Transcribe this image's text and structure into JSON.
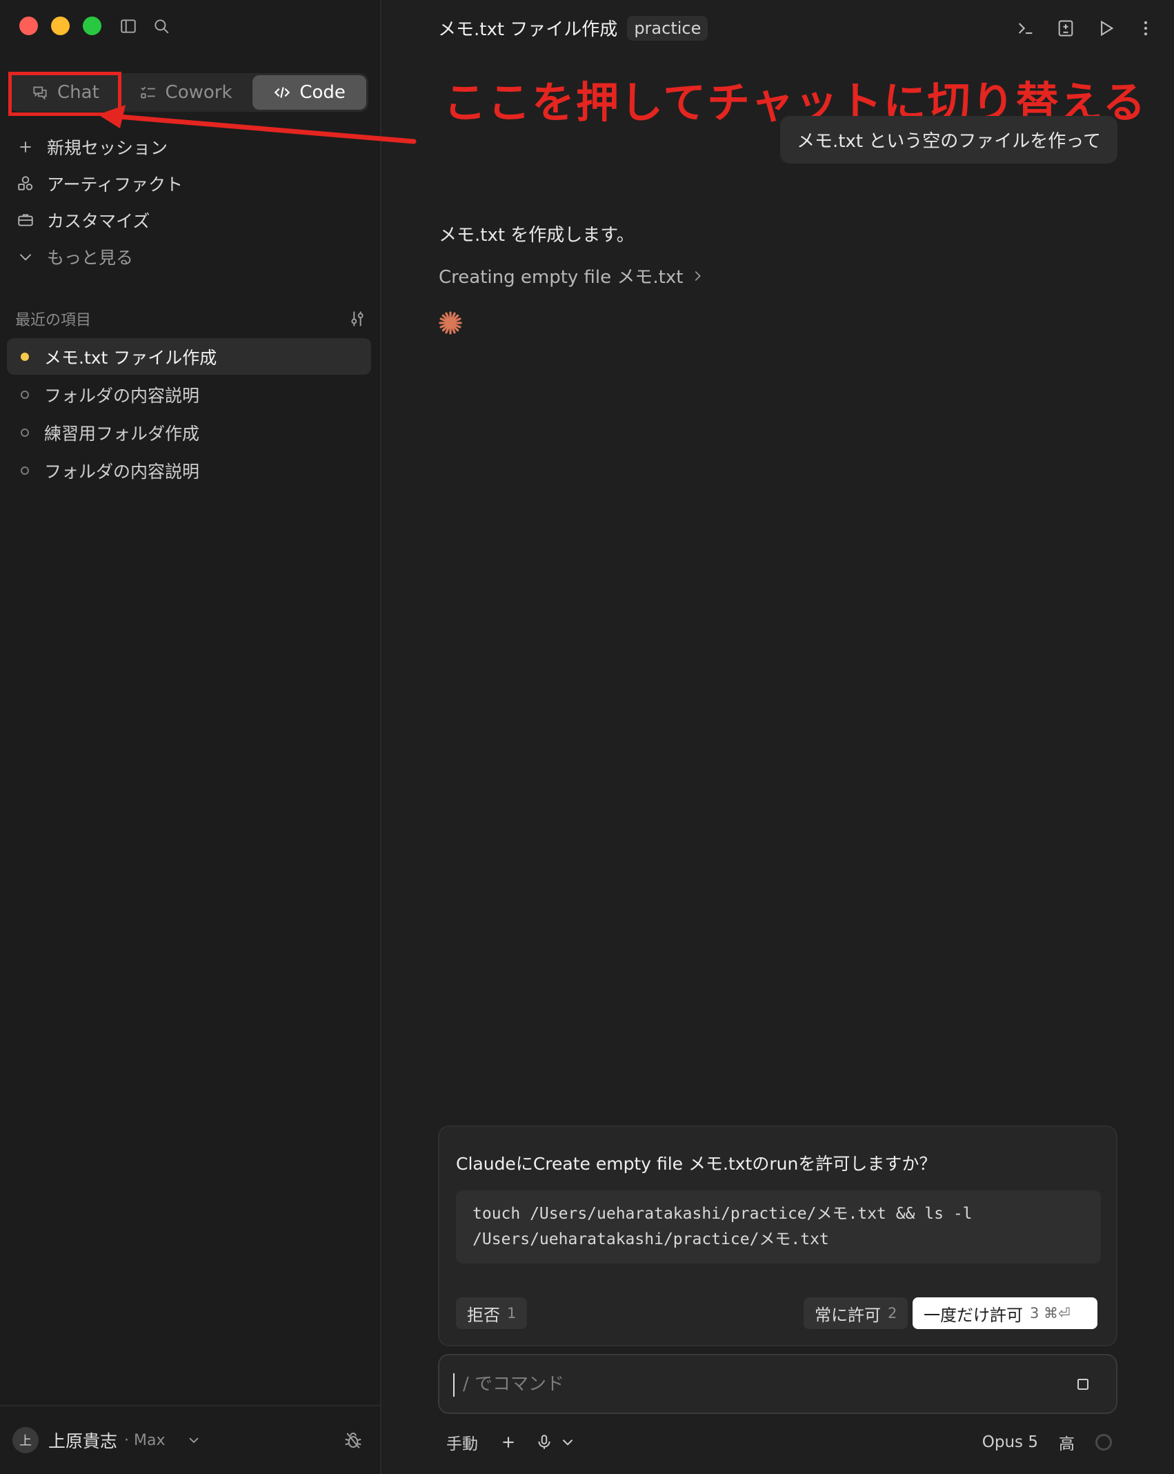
{
  "sidebar": {
    "modes": [
      {
        "label": "Chat",
        "icon": "chat-bubble-icon"
      },
      {
        "label": "Cowork",
        "icon": "checklist-icon"
      },
      {
        "label": "Code",
        "icon": "code-brackets-icon",
        "selected": true
      }
    ],
    "nav": [
      {
        "label": "新規セッション",
        "icon": "plus-icon"
      },
      {
        "label": "アーティファクト",
        "icon": "shapes-icon"
      },
      {
        "label": "カスタマイズ",
        "icon": "briefcase-icon"
      },
      {
        "label": "もっと見る",
        "icon": "chevron-down-icon"
      }
    ],
    "recent_title": "最近の項目",
    "recent": [
      {
        "label": "メモ.txt ファイル作成",
        "active": true
      },
      {
        "label": "フォルダの内容説明",
        "active": false
      },
      {
        "label": "練習用フォルダ作成",
        "active": false
      },
      {
        "label": "フォルダの内容説明",
        "active": false
      }
    ],
    "user": {
      "avatar": "上",
      "name": "上原貴志",
      "plan": "· Max"
    }
  },
  "main": {
    "title": "メモ.txt ファイル作成",
    "project": "practice",
    "annotation": "ここを押してチャットに切り替える",
    "user_message": "メモ.txt という空のファイルを作って",
    "assistant_message": "メモ.txt を作成します。",
    "tool_line": "Creating empty file メモ.txt",
    "permission": {
      "question": "ClaudeにCreate empty file メモ.txtのrunを許可しますか？",
      "command_line1": "touch /Users/ueharatakashi/practice/メモ.txt && ls -l",
      "command_line2": "/Users/ueharatakashi/practice/メモ.txt",
      "deny": {
        "label": "拒否",
        "key": "1"
      },
      "always": {
        "label": "常に許可",
        "key": "2"
      },
      "once": {
        "label": "一度だけ許可",
        "key": "3 ⌘⏎"
      }
    },
    "composer": {
      "placeholder": "/ でコマンド",
      "mode": "手動",
      "model": "Opus 5",
      "effort": "高"
    }
  },
  "colors": {
    "annotation": "#e52520",
    "spinner": "#d97757",
    "active_dot": "#f5c94a"
  }
}
